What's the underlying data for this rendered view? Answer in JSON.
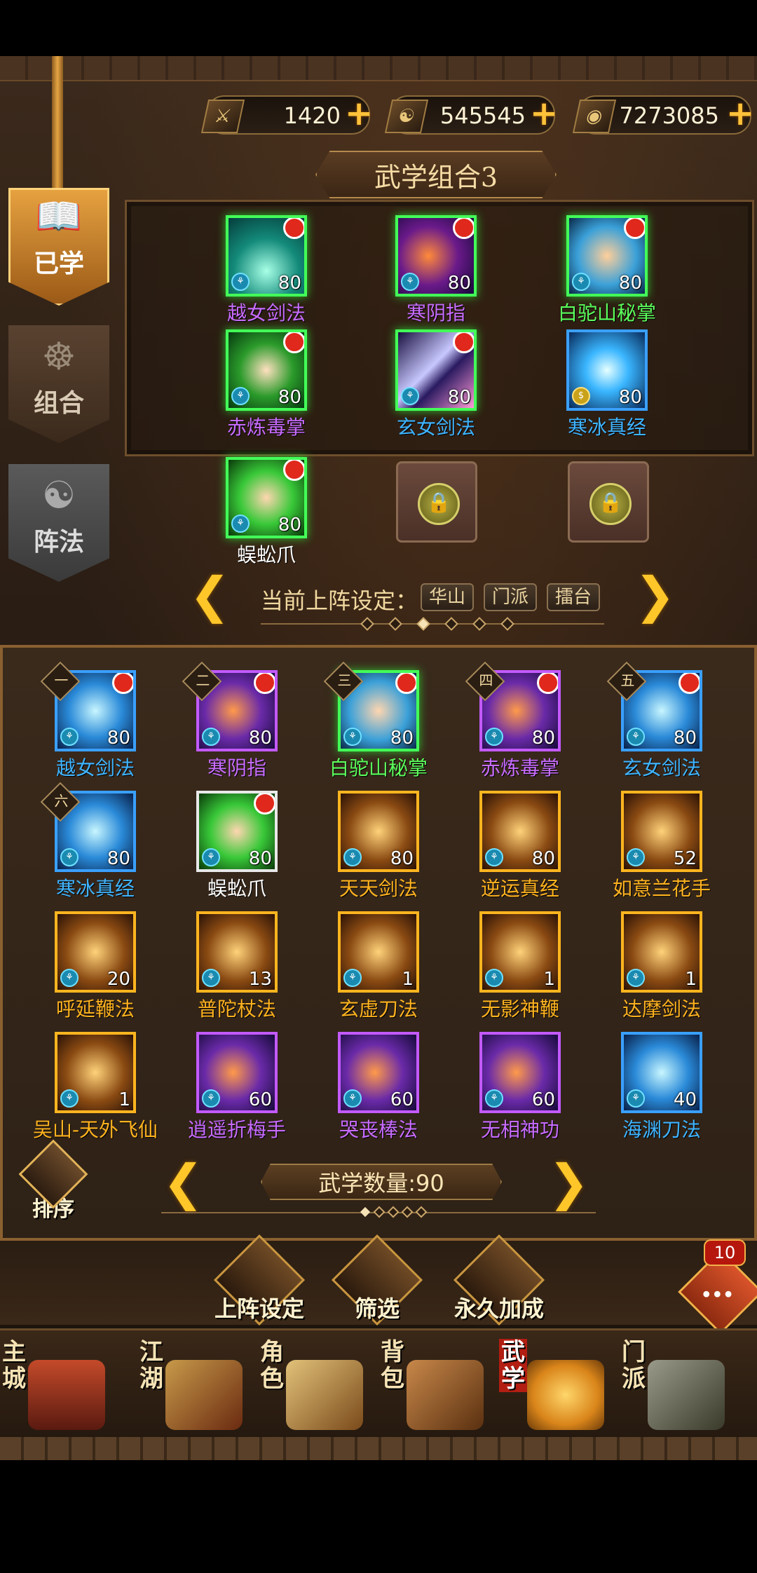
{
  "currencies": [
    {
      "icon": "crossed-swords-icon",
      "value": "1420"
    },
    {
      "icon": "yinyang-coin-icon",
      "value": "545545"
    },
    {
      "icon": "silver-coin-icon",
      "value": "7273085"
    }
  ],
  "left_tabs": [
    {
      "label": "已学",
      "state": "active"
    },
    {
      "label": "组合",
      "state": "normal"
    },
    {
      "label": "阵法",
      "state": "disabled"
    }
  ],
  "combo": {
    "title": "武学组合3",
    "skills": [
      {
        "name": "越女剑法",
        "level": "80",
        "rarity": "blue",
        "dot": true
      },
      {
        "name": "寒阴指",
        "level": "80",
        "rarity": "purple",
        "dot": true
      },
      {
        "name": "白驼山秘掌",
        "level": "80",
        "rarity": "green",
        "dot": true
      },
      {
        "name": "赤炼毒掌",
        "level": "80",
        "rarity": "purple",
        "dot": true
      },
      {
        "name": "玄女剑法",
        "level": "80",
        "rarity": "blue",
        "dot": true
      },
      {
        "name": "寒冰真经",
        "level": "80",
        "rarity": "blue",
        "dot": false
      },
      {
        "name": "蜈蚣爪",
        "level": "80",
        "rarity": "white",
        "dot": true
      }
    ],
    "locked_slots": 2
  },
  "lineup": {
    "label": "当前上阵设定：",
    "tags": [
      "华山",
      "门派",
      "擂台"
    ]
  },
  "learned": {
    "skills": [
      {
        "name": "越女剑法",
        "level": "80",
        "rarity": "blue",
        "rank": "一",
        "dot": true
      },
      {
        "name": "寒阴指",
        "level": "80",
        "rarity": "purple",
        "rank": "二",
        "dot": true
      },
      {
        "name": "白驼山秘掌",
        "level": "80",
        "rarity": "green",
        "rank": "三",
        "dot": true
      },
      {
        "name": "赤炼毒掌",
        "level": "80",
        "rarity": "purple",
        "rank": "四",
        "dot": true
      },
      {
        "name": "玄女剑法",
        "level": "80",
        "rarity": "blue",
        "rank": "五",
        "dot": true
      },
      {
        "name": "寒冰真经",
        "level": "80",
        "rarity": "blue",
        "rank": "六",
        "dot": false
      },
      {
        "name": "蜈蚣爪",
        "level": "80",
        "rarity": "white",
        "rank": "",
        "dot": true
      },
      {
        "name": "天天剑法",
        "level": "80",
        "rarity": "orange",
        "rank": "",
        "dot": false
      },
      {
        "name": "逆运真经",
        "level": "80",
        "rarity": "orange",
        "rank": "",
        "dot": false
      },
      {
        "name": "如意兰花手",
        "level": "52",
        "rarity": "orange",
        "rank": "",
        "dot": false
      },
      {
        "name": "呼延鞭法",
        "level": "20",
        "rarity": "orange",
        "rank": "",
        "dot": false
      },
      {
        "name": "普陀杖法",
        "level": "13",
        "rarity": "orange",
        "rank": "",
        "dot": false
      },
      {
        "name": "玄虚刀法",
        "level": "1",
        "rarity": "orange",
        "rank": "",
        "dot": false
      },
      {
        "name": "无影神鞭",
        "level": "1",
        "rarity": "orange",
        "rank": "",
        "dot": false
      },
      {
        "name": "达摩剑法",
        "level": "1",
        "rarity": "orange",
        "rank": "",
        "dot": false
      },
      {
        "name": "吴山-天外飞仙",
        "level": "1",
        "rarity": "orange",
        "rank": "",
        "dot": false
      },
      {
        "name": "逍遥折梅手",
        "level": "60",
        "rarity": "purple",
        "rank": "",
        "dot": false
      },
      {
        "name": "哭丧棒法",
        "level": "60",
        "rarity": "purple",
        "rank": "",
        "dot": false
      },
      {
        "name": "无相神功",
        "level": "60",
        "rarity": "purple",
        "rank": "",
        "dot": false
      },
      {
        "name": "海渊刀法",
        "level": "40",
        "rarity": "blue",
        "rank": "",
        "dot": false
      }
    ],
    "count_label": "武学数量:90",
    "sort_label": "排序"
  },
  "actions": [
    "上阵设定",
    "筛选",
    "永久加成"
  ],
  "chat_badge": "10",
  "nav": [
    {
      "label": "主城",
      "icon": "palace-icon"
    },
    {
      "label": "江湖",
      "icon": "banner-icon"
    },
    {
      "label": "角色",
      "icon": "scroll-icon"
    },
    {
      "label": "背包",
      "icon": "bag-icon"
    },
    {
      "label": "武学",
      "icon": "book-icon",
      "active": true
    },
    {
      "label": "门派",
      "icon": "cauldron-icon"
    }
  ],
  "colors": {
    "blue": "#3fb4ff",
    "purple": "#c86cff",
    "green": "#5dff5d",
    "orange": "#ffb31f",
    "white": "#ffffff",
    "accent": "#ffc62a"
  }
}
